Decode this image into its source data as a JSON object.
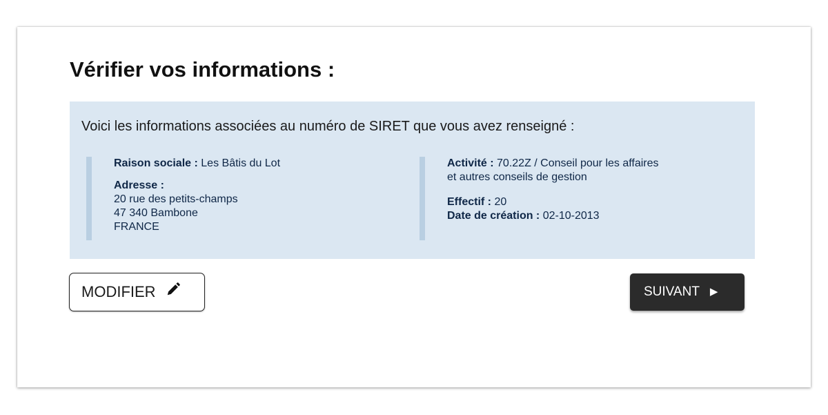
{
  "title": "Vérifier vos informations :",
  "info": {
    "intro": "Voici les informations associées au numéro de SIRET que vous avez renseigné :",
    "left": {
      "raison_sociale_label": "Raison sociale :",
      "raison_sociale_value": "Les Bâtis du Lot",
      "adresse_label": "Adresse :",
      "adresse_lines": [
        "20 rue des petits-champs",
        "47 340 Bambone",
        "FRANCE"
      ]
    },
    "right": {
      "activite_label": "Activité :",
      "activite_value_line1": "70.22Z / Conseil pour les affaires",
      "activite_value_line2": "et autres conseils de gestion",
      "effectif_label": "Effectif :",
      "effectif_value": "20",
      "date_label": "Date de création :",
      "date_value": "02-10-2013"
    }
  },
  "buttons": {
    "modify_label": "MODIFIER",
    "modify_icon": "pencil-icon",
    "next_label": "SUIVANT",
    "next_icon": "play-arrow-icon"
  },
  "colors": {
    "info_background": "#dbe7f2",
    "info_border": "#b9cfe2",
    "info_text": "#0f2747",
    "next_button_bg": "#2b2b2b"
  }
}
